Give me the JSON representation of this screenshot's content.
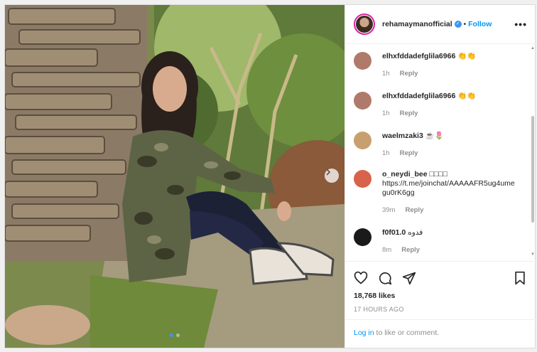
{
  "header": {
    "username": "rehamaymanofficial",
    "separator": "•",
    "follow_label": "Follow",
    "more_label": "•••"
  },
  "comments": [
    {
      "user": "elhxfddadefglila6966",
      "text": "👏👏",
      "time": "1h",
      "reply": "Reply",
      "avatar_color": "#b07a6a"
    },
    {
      "user": "elhxfddadefglila6966",
      "text": "👏👏",
      "time": "1h",
      "reply": "Reply",
      "avatar_color": "#b07a6a"
    },
    {
      "user": "waelmzaki3",
      "text": "☕🌷",
      "time": "1h",
      "reply": "Reply",
      "avatar_color": "#c8a070"
    },
    {
      "user": "o_neydi_bee",
      "text": "□□□□ https://t.me/joinchat/AAAAAFR5ug4umegu0rK6gg",
      "time": "39m",
      "reply": "Reply",
      "avatar_color": "#d9624a"
    },
    {
      "user": "f0f01.0",
      "text": "فدوه",
      "time": "8m",
      "reply": "Reply",
      "avatar_color": "#1a1a1a"
    }
  ],
  "actions": {
    "likes": "18,768 likes",
    "time": "17 HOURS AGO"
  },
  "login": {
    "link": "Log in",
    "text": " to like or comment."
  },
  "colors": {
    "accent": "#0095f6",
    "muted": "#8e8e8e"
  }
}
